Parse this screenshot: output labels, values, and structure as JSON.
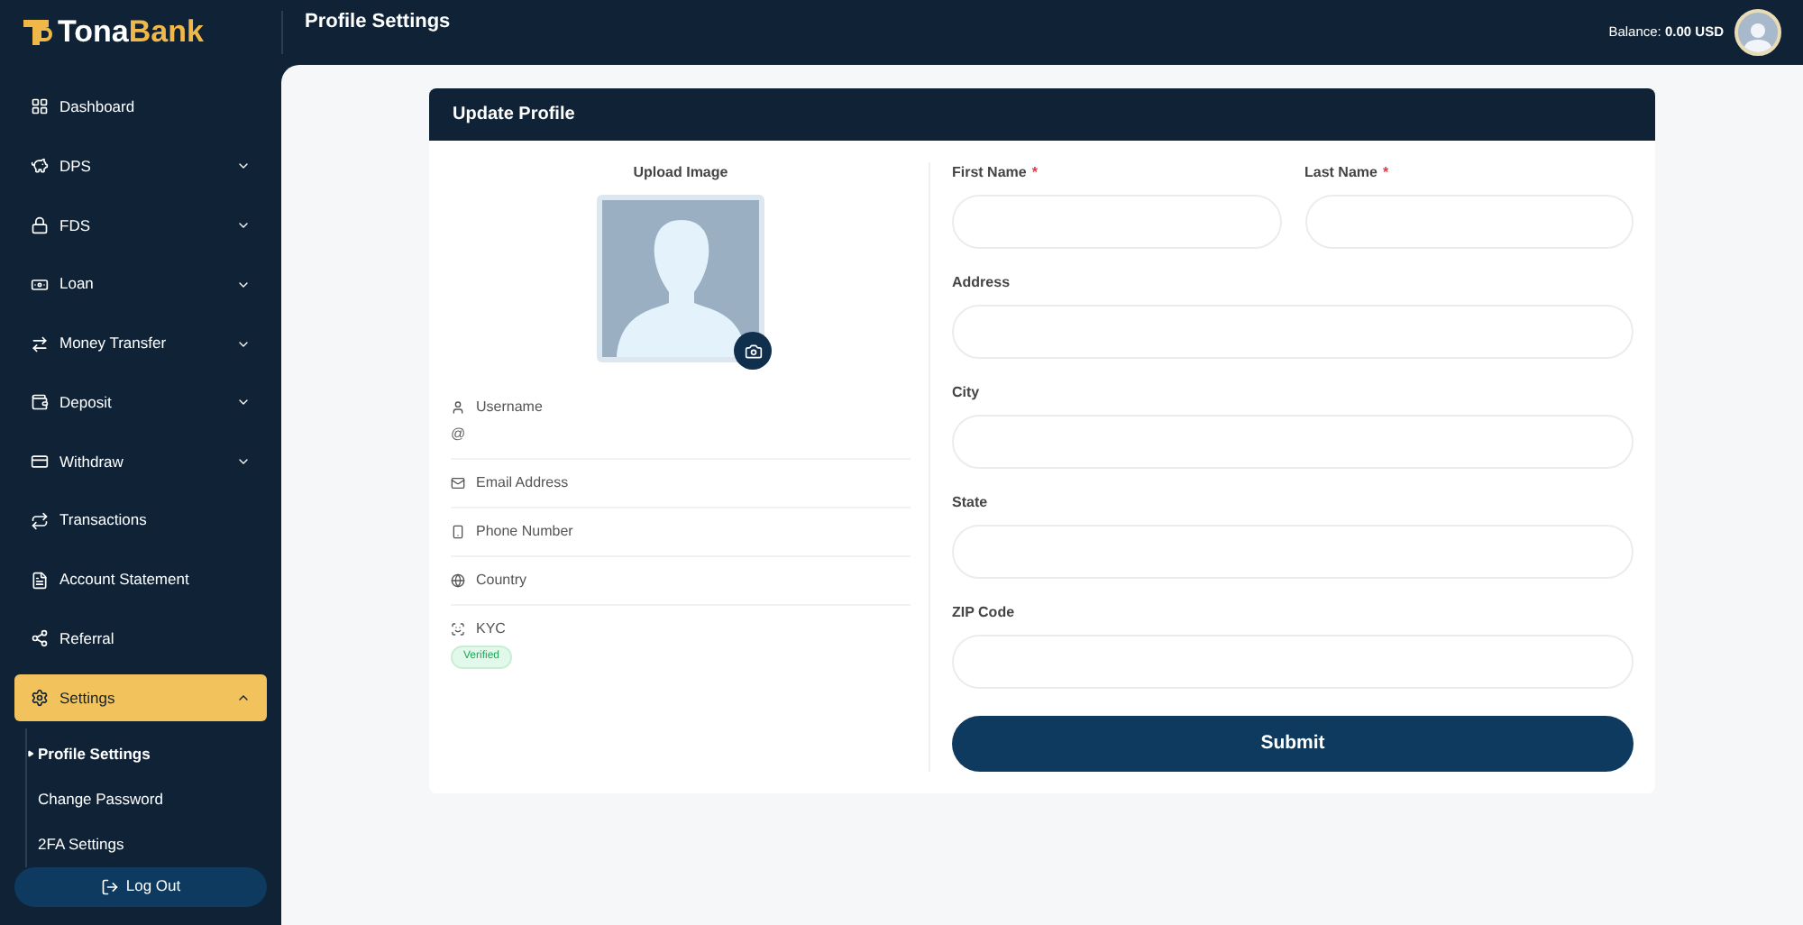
{
  "brand": {
    "first": "Tona",
    "second": "Bank"
  },
  "header": {
    "title": "Profile Settings",
    "balance": "Balance: **0.00 USD**"
  },
  "sidebar": {
    "items": [
      {
        "kind": "link",
        "label": "Dashboard",
        "selected": false
      },
      {
        "kind": "menu",
        "label": "DPS",
        "expanded": false,
        "selected": false
      },
      {
        "kind": "menu",
        "label": "FDS",
        "expanded": false,
        "selected": false
      },
      {
        "kind": "menu",
        "label": "Loan",
        "expanded": false,
        "selected": false
      },
      {
        "kind": "menu",
        "label": "Money Transfer",
        "expanded": false,
        "selected": false
      },
      {
        "kind": "menu",
        "label": "Deposit",
        "expanded": false,
        "selected": false
      },
      {
        "kind": "menu",
        "label": "Withdraw",
        "expanded": false,
        "selected": false
      },
      {
        "kind": "link",
        "label": "Transactions",
        "selected": false
      },
      {
        "kind": "link",
        "label": "Account Statement",
        "selected": false
      },
      {
        "kind": "link",
        "label": "Referral",
        "selected": false
      },
      {
        "kind": "menu",
        "label": "Settings",
        "expanded": true,
        "selected": true,
        "children": [
          {
            "label": "Profile Settings",
            "selected": true
          },
          {
            "label": "Change Password",
            "selected": false
          },
          {
            "label": "2FA Settings",
            "selected": false
          }
        ]
      }
    ],
    "logout": "Log Out"
  },
  "card": {
    "title": "Update Profile",
    "upload_label": "Upload Image",
    "info": [
      {
        "kind": "user",
        "label": "Username",
        "value": "@"
      },
      {
        "kind": "email",
        "label": "Email Address"
      },
      {
        "kind": "phone",
        "label": "Phone Number"
      },
      {
        "kind": "globe",
        "label": "Country"
      },
      {
        "kind": "kyc",
        "label": "KYC",
        "badge": "Verified"
      }
    ],
    "fields": [
      {
        "label": "First Name",
        "required_mark": "*"
      },
      {
        "label": "Last Name",
        "required_mark": "*"
      },
      {
        "label": "Address"
      },
      {
        "label": "City"
      },
      {
        "label": "State"
      },
      {
        "label": "ZIP Code"
      }
    ],
    "submit": "Submit"
  }
}
